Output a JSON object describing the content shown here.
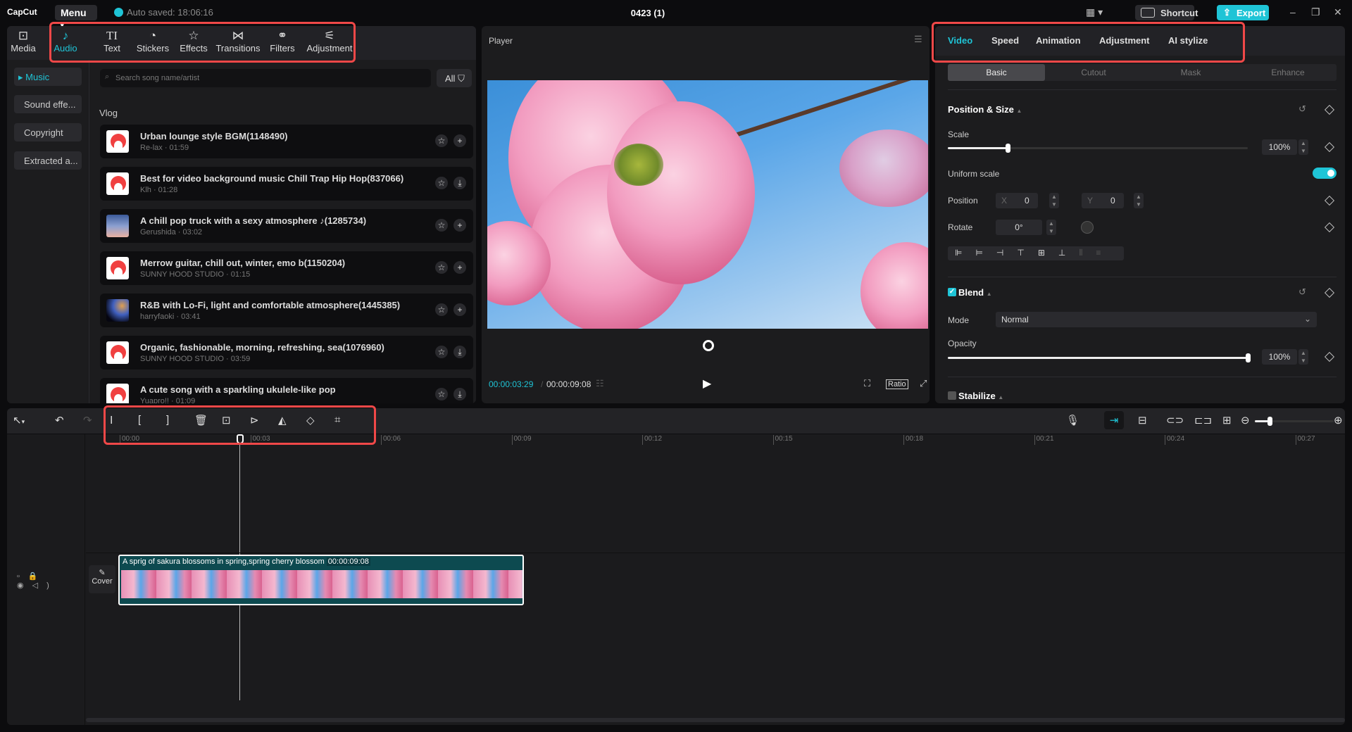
{
  "titlebar": {
    "app_name": "CapCut",
    "menu_label": "Menu",
    "autosave": "Auto saved: 18:06:16",
    "project_title": "0423 (1)",
    "shortcut_label": "Shortcut",
    "export_label": "Export",
    "layout_icon": "layout-icon"
  },
  "left_panel": {
    "tabs": [
      {
        "label": "Media",
        "icon": "media-icon"
      },
      {
        "label": "Audio",
        "icon": "music-note-icon"
      },
      {
        "label": "Text",
        "icon": "text-icon"
      },
      {
        "label": "Stickers",
        "icon": "sticker-icon"
      },
      {
        "label": "Effects",
        "icon": "effects-star-icon"
      },
      {
        "label": "Transitions",
        "icon": "transition-bowtie-icon"
      },
      {
        "label": "Filters",
        "icon": "filters-circles-icon"
      },
      {
        "label": "Adjustment",
        "icon": "sliders-icon"
      }
    ],
    "active_tab": "Audio",
    "categories": [
      {
        "label": "Music"
      },
      {
        "label": "Sound effe..."
      },
      {
        "label": "Copyright"
      },
      {
        "label": "Extracted a..."
      }
    ],
    "search_placeholder": "Search song name/artist",
    "filter_label": "All",
    "section_title": "Vlog",
    "songs": [
      {
        "title": "Urban lounge style BGM(1148490)",
        "sub": "Re-lax · 01:59",
        "action": "add"
      },
      {
        "title": "Best for video background music Chill Trap Hip Hop(837066)",
        "sub": "Klh · 01:28",
        "action": "download"
      },
      {
        "title": "A chill pop truck with a sexy atmosphere ♪(1285734)",
        "sub": "Gerushida · 03:02",
        "action": "add"
      },
      {
        "title": "Merrow guitar, chill out, winter, emo b(1150204)",
        "sub": "SUNNY HOOD STUDIO · 01:15",
        "action": "add"
      },
      {
        "title": "R&B with Lo-Fi, light and comfortable atmosphere(1445385)",
        "sub": "harryfaoki · 03:41",
        "action": "add"
      },
      {
        "title": "Organic, fashionable, morning, refreshing, sea(1076960)",
        "sub": "SUNNY HOOD STUDIO · 03:59",
        "action": "download"
      },
      {
        "title": "A cute song with a sparkling ukulele-like pop",
        "sub": "Yuapro!! · 01:09",
        "action": "download"
      }
    ]
  },
  "player": {
    "title": "Player",
    "current_time": "00:00:03:29",
    "total_time": "00:00:09:08",
    "ratio_label": "Ratio"
  },
  "inspector": {
    "tabs": [
      "Video",
      "Speed",
      "Animation",
      "Adjustment",
      "AI stylize"
    ],
    "active_tab": "Video",
    "subtabs": [
      "Basic",
      "Cutout",
      "Mask",
      "Enhance"
    ],
    "active_subtab": "Basic",
    "position_size": {
      "title": "Position & Size",
      "scale_label": "Scale",
      "scale_value": "100%",
      "scale_fraction": 0.2,
      "uniform_label": "Uniform scale",
      "uniform_on": true,
      "position_label": "Position",
      "x_label": "X",
      "x_value": "0",
      "y_label": "Y",
      "y_value": "0",
      "rotate_label": "Rotate",
      "rotate_value": "0°"
    },
    "blend": {
      "title": "Blend",
      "checked": true,
      "mode_label": "Mode",
      "mode_value": "Normal",
      "opacity_label": "Opacity",
      "opacity_value": "100%",
      "opacity_fraction": 1.0
    },
    "stabilize": {
      "title": "Stabilize",
      "checked": false
    }
  },
  "timeline": {
    "ruler": [
      "00:00",
      "00:03",
      "00:06",
      "00:09",
      "00:12",
      "00:15",
      "00:18",
      "00:21",
      "00:24",
      "00:27"
    ],
    "clip": {
      "title": "A sprig of sakura blossoms in spring,spring cherry blossom",
      "duration": "00:00:09:08"
    },
    "cover_label": "Cover",
    "accent": "#1fc4d6",
    "highlight": "#f04848"
  }
}
